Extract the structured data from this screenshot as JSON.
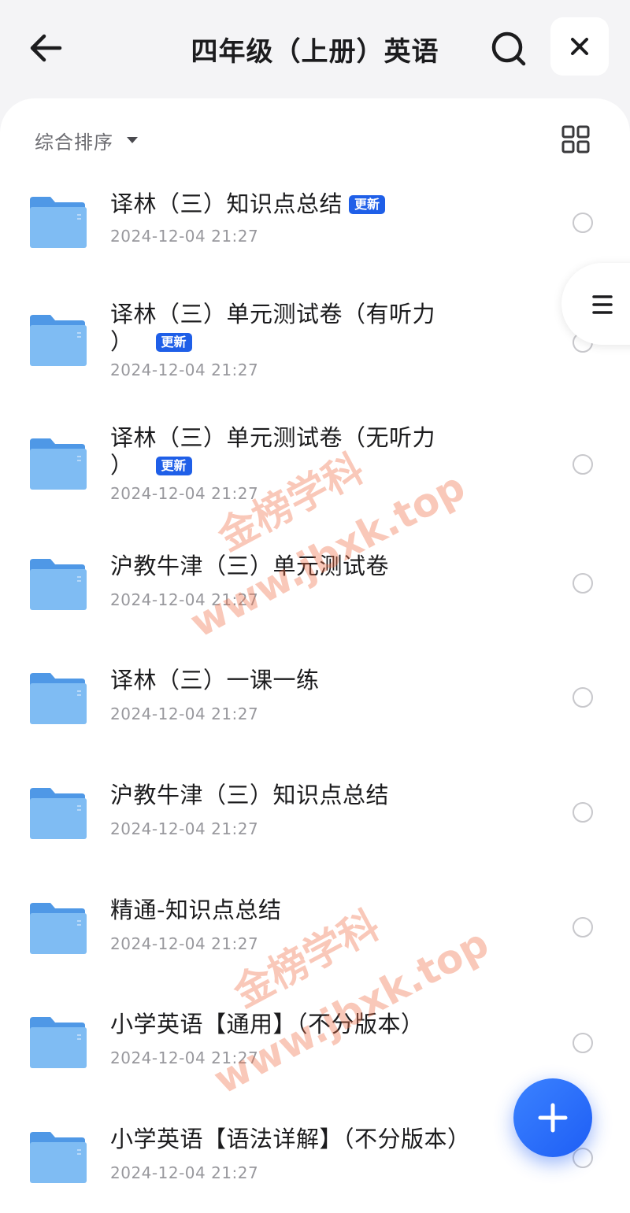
{
  "header": {
    "title": "四年级（上册）英语"
  },
  "sort": {
    "label": "综合排序"
  },
  "badge_label": "更新",
  "items": [
    {
      "name": "译林（三）知识点总结",
      "date": "2024-12-04 21:27"
    },
    {
      "name_line1": "译林（三）单元测试卷（有听力",
      "name_line2": "）",
      "date": "2024-12-04 21:27"
    },
    {
      "name_line1": "译林（三）单元测试卷（无听力",
      "name_line2": "）",
      "date": "2024-12-04 21:27"
    },
    {
      "name": "沪教牛津（三）单元测试卷",
      "date": "2024-12-04 21:27"
    },
    {
      "name": "译林（三）一课一练",
      "date": "2024-12-04 21:27"
    },
    {
      "name": "沪教牛津（三）知识点总结",
      "date": "2024-12-04 21:27"
    },
    {
      "name": "精通-知识点总结",
      "date": "2024-12-04 21:27"
    },
    {
      "name": "小学英语【通用】（不分版本）",
      "date": "2024-12-04 21:27"
    },
    {
      "name": "小学英语【语法详解】（不分版本）",
      "date": "2024-12-04 21:27"
    }
  ],
  "watermark": {
    "line1": "金榜学科",
    "line2": "www.jbxk.top"
  },
  "colors": {
    "accent": "#1f5fe8",
    "folder": "#6aaef0"
  }
}
